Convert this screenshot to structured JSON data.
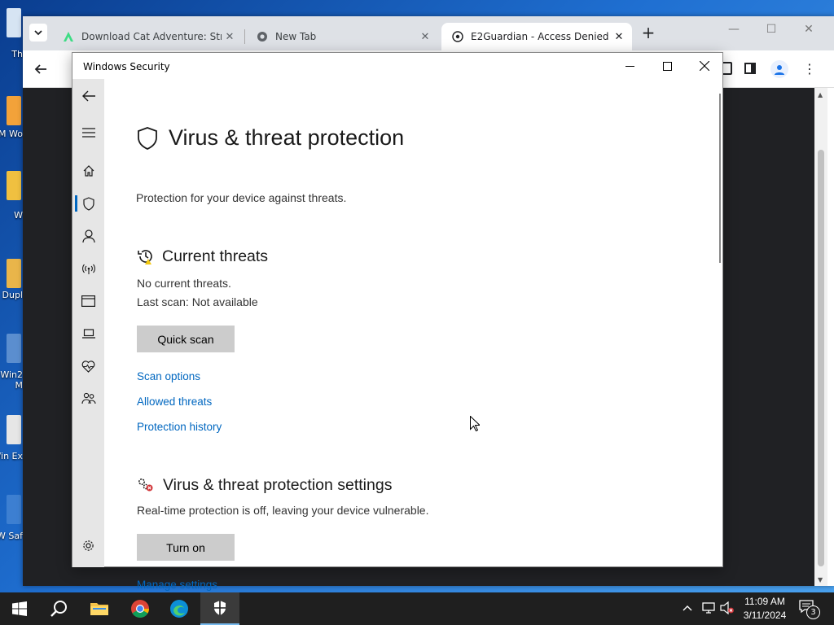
{
  "desktop": {
    "icons": [
      "Th",
      "VM Wo",
      "W",
      "W Dupl",
      "Win2 M",
      "Win Ex",
      "W Saf"
    ]
  },
  "browser": {
    "tabs": [
      {
        "title": "Download Cat Adventure: Stray",
        "icon": "android-icon",
        "active": false
      },
      {
        "title": "New Tab",
        "icon": "chrome-icon",
        "active": false
      },
      {
        "title": "E2Guardian - Access Denied",
        "icon": "globe-icon",
        "active": true
      }
    ]
  },
  "security": {
    "window_title": "Windows Security",
    "page_title": "Virus & threat protection",
    "subtitle": "Protection for your device against threats.",
    "threats": {
      "heading": "Current threats",
      "status": "No current threats.",
      "last_scan": "Last scan: Not available",
      "quick_scan": "Quick scan",
      "links": [
        "Scan options",
        "Allowed threats",
        "Protection history"
      ]
    },
    "settings": {
      "heading": "Virus & threat protection settings",
      "status": "Real-time protection is off, leaving your device vulnerable.",
      "turn_on": "Turn on",
      "manage": "Manage settings"
    }
  },
  "taskbar": {
    "time": "11:09 AM",
    "date": "3/11/2024",
    "notification_count": "3"
  },
  "colors": {
    "accent": "#0067c0",
    "warning": "#d13438"
  }
}
